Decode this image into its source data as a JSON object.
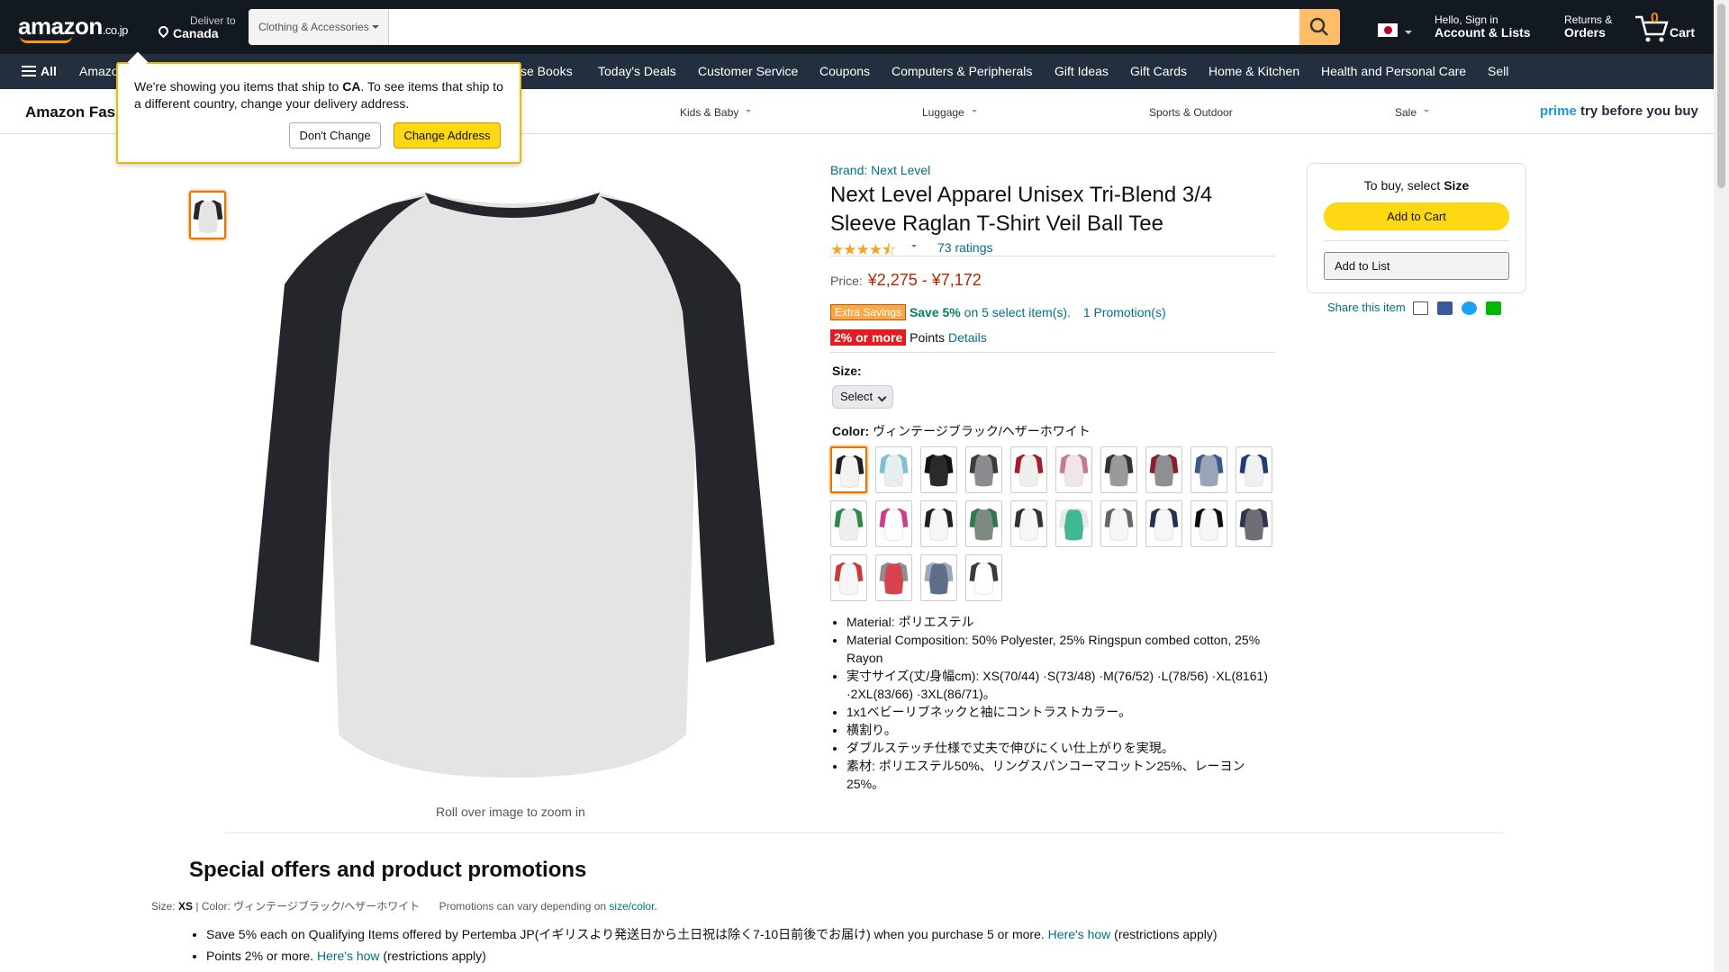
{
  "header": {
    "logo_text": "amazon",
    "logo_suffix": ".co.jp",
    "deliver_label": "Deliver to",
    "deliver_location": "Canada",
    "search_category": "Clothing & Accessories",
    "search_placeholder": "",
    "account_greeting": "Hello, Sign in",
    "account_label": "Account & Lists",
    "returns_top": "Returns &",
    "returns_bottom": "Orders",
    "cart_count": "0",
    "cart_label": "Cart"
  },
  "nav": {
    "all_label": "All",
    "items": [
      "Amazon",
      "se Books",
      "Today's Deals",
      "Customer Service",
      "Coupons",
      "Computers & Peripherals",
      "Gift Ideas",
      "Gift Cards",
      "Home & Kitchen",
      "Health and Personal Care",
      "Sell"
    ]
  },
  "subnav": {
    "title": "Amazon Fas",
    "items": [
      "Kids & Baby",
      "Luggage",
      "Sports & Outdoor",
      "Sale"
    ],
    "prime_word": "prime",
    "prime_tagline": "try before you buy"
  },
  "popover": {
    "text_before": "We're showing you items that ship to ",
    "country": "CA",
    "text_after": ". To see items that ship to a different country, change your delivery address.",
    "dont_change": "Don't Change",
    "change_address": "Change Address"
  },
  "gallery": {
    "zoom_note": "Roll over image to zoom in",
    "body_color": "#e4e4e4",
    "sleeve_color": "#25262b"
  },
  "product": {
    "brand": "Brand: Next Level",
    "title": "Next Level Apparel Unisex Tri-Blend 3/4 Sleeve Raglan T-Shirt Veil Ball Tee",
    "stars": "★★★★⯪",
    "rating_fraction": 0.9,
    "ratings_count": "73 ratings",
    "price_label": "Price:",
    "price_range": "¥2,275 - ¥7,172",
    "extra_savings_badge": "Extra Savings",
    "save_bold": "Save 5%",
    "save_rest": " on 5 select item(s).",
    "promotions": "1 Promotion(s)",
    "points_badge": "2% or more",
    "points_label": " Points ",
    "points_details": "Details",
    "size_label": "Size:",
    "size_value": "Select",
    "color_label": "Color:",
    "color_value": "ヴィンテージブラック/ヘザーホワイト",
    "swatches": [
      {
        "body": "#f2f2f2",
        "sleeve": "#1e1f24"
      },
      {
        "body": "#e6eef0",
        "sleeve": "#7fc2cf"
      },
      {
        "body": "#2a2a2a",
        "sleeve": "#111111"
      },
      {
        "body": "#8a8c90",
        "sleeve": "#3a3b3f"
      },
      {
        "body": "#efefef",
        "sleeve": "#a31d2a"
      },
      {
        "body": "#f0e6ea",
        "sleeve": "#c77a8c"
      },
      {
        "body": "#9a9a9a",
        "sleeve": "#333333"
      },
      {
        "body": "#8d8f93",
        "sleeve": "#8c1f2d"
      },
      {
        "body": "#9aa4b6",
        "sleeve": "#3b5a8a"
      },
      {
        "body": "#f0f0f0",
        "sleeve": "#233a7a"
      },
      {
        "body": "#efefef",
        "sleeve": "#2e8a46"
      },
      {
        "body": "#ffffff",
        "sleeve": "#d33b8a"
      },
      {
        "body": "#f6f6f6",
        "sleeve": "#202020"
      },
      {
        "body": "#7c8a82",
        "sleeve": "#2d7a48"
      },
      {
        "body": "#f6f6f6",
        "sleeve": "#333333"
      },
      {
        "body": "#3fb893",
        "sleeve": "#e9e9e9"
      },
      {
        "body": "#f6f6f6",
        "sleeve": "#666666"
      },
      {
        "body": "#f6f6f6",
        "sleeve": "#1f3350"
      },
      {
        "body": "#f6f6f6",
        "sleeve": "#0d0d0d"
      },
      {
        "body": "#6e6e76",
        "sleeve": "#2f3550"
      },
      {
        "body": "#f6f6f6",
        "sleeve": "#c63a3a"
      },
      {
        "body": "#d8424c",
        "sleeve": "#8e8e8e"
      },
      {
        "body": "#5e6e87",
        "sleeve": "#9aa9bd"
      },
      {
        "body": "#ffffff",
        "sleeve": "#3a3a3a"
      }
    ],
    "bullets": [
      "Material: ポリエステル",
      "Material Composition: 50% Polyester, 25% Ringspun combed cotton, 25% Rayon",
      "実寸サイズ(丈/身幅cm): XS(70/44) ·S(73/48) ·M(76/52) ·L(78/56) ·XL(8161) ·2XL(83/66) ·3XL(86/71)。",
      "1x1ベビーリブネックと袖にコントラストカラー。",
      "横割り。",
      "ダブルステッチ仕様で丈夫で伸びにくい仕上がりを実現。",
      "素材: ポリエステル50%、リングスパンコーマコットン25%、レーヨン25%。"
    ]
  },
  "buybox": {
    "prompt_before": "To buy, select ",
    "prompt_bold": "Size",
    "add_to_cart": "Add to Cart",
    "add_to_list": "Add to List",
    "share_label": "Share this item"
  },
  "special": {
    "heading": "Special offers and product promotions",
    "size_label": "Size: ",
    "size_value": "XS",
    "separator": " | ",
    "color_label": "Color: ",
    "color_value": "ヴィンテージブラック/ヘザーホワイト",
    "vary_text": "Promotions can vary depending on ",
    "vary_link": "size/color",
    "vary_end": ".",
    "offer1_text": "Save 5% each on Qualifying Items offered by Pertemba JP(イギリスより発送日から土日祝は除く7-10日前後でお届け) when you purchase 5 or more. ",
    "offer1_link": "Here's how",
    "offer1_end": " (restrictions apply)",
    "offer2_text": "Points 2% or more. ",
    "offer2_link": "Here's how",
    "offer2_end": " (restrictions apply)"
  },
  "colors": {
    "header_bg": "#131921",
    "nav_bg": "#232f3e",
    "accent": "#ff9900",
    "link": "#007185",
    "price": "#b12704",
    "cart_button": "#ffd814"
  }
}
